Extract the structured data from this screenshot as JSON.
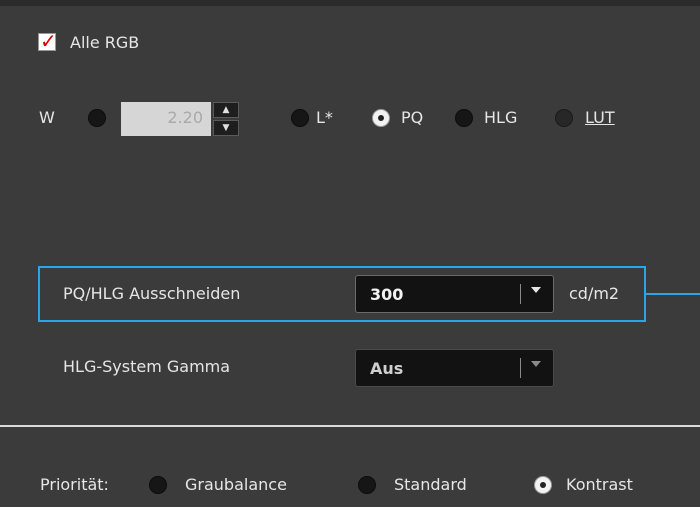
{
  "all_rgb": {
    "label": "Alle RGB",
    "checked": true
  },
  "gamma_row": {
    "w_label": "W",
    "gamma_value": "2.20",
    "spin_up_icon": "triangle-up-icon",
    "spin_down_icon": "triangle-down-icon",
    "options": [
      {
        "label": "L*",
        "selected": false
      },
      {
        "label": "PQ",
        "selected": true
      },
      {
        "label": "HLG",
        "selected": false
      },
      {
        "label": "LUT",
        "selected": false,
        "disabled": true
      }
    ]
  },
  "pq_hlg_clip": {
    "label": "PQ/HLG Ausschneiden",
    "value": "300",
    "unit": "cd/m2"
  },
  "hlg_system_gamma": {
    "label": "HLG-System Gamma",
    "value": "Aus"
  },
  "priority": {
    "label": "Priorität:",
    "options": [
      {
        "label": "Graubalance",
        "selected": false
      },
      {
        "label": "Standard",
        "selected": false
      },
      {
        "label": "Kontrast",
        "selected": true
      }
    ]
  },
  "colors": {
    "background": "#3b3b3b",
    "highlight": "#29a6e8",
    "checkmark": "#d40000"
  }
}
